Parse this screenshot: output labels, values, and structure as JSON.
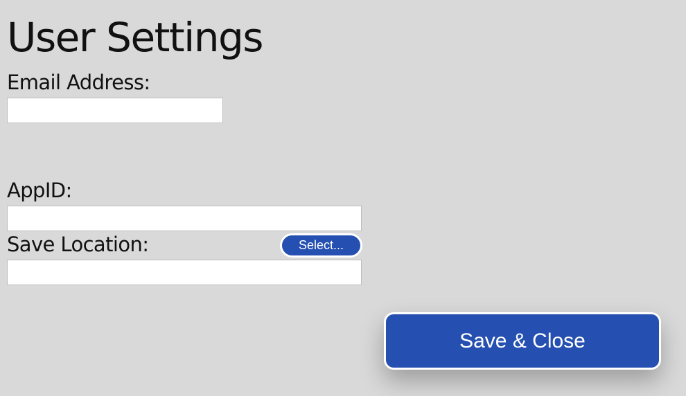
{
  "page": {
    "title": "User Settings"
  },
  "form": {
    "email": {
      "label": "Email Address:",
      "value": "",
      "placeholder": ""
    },
    "app_id": {
      "label": "AppID:",
      "value": "",
      "placeholder": ""
    },
    "save_location": {
      "label": "Save Location:",
      "value": "",
      "placeholder": "",
      "select_label": "Select..."
    }
  },
  "actions": {
    "save_close_label": "Save & Close"
  },
  "colors": {
    "background": "#d9d9d9",
    "accent": "#2550b1",
    "input_background": "#ffffff",
    "text": "#111111"
  }
}
